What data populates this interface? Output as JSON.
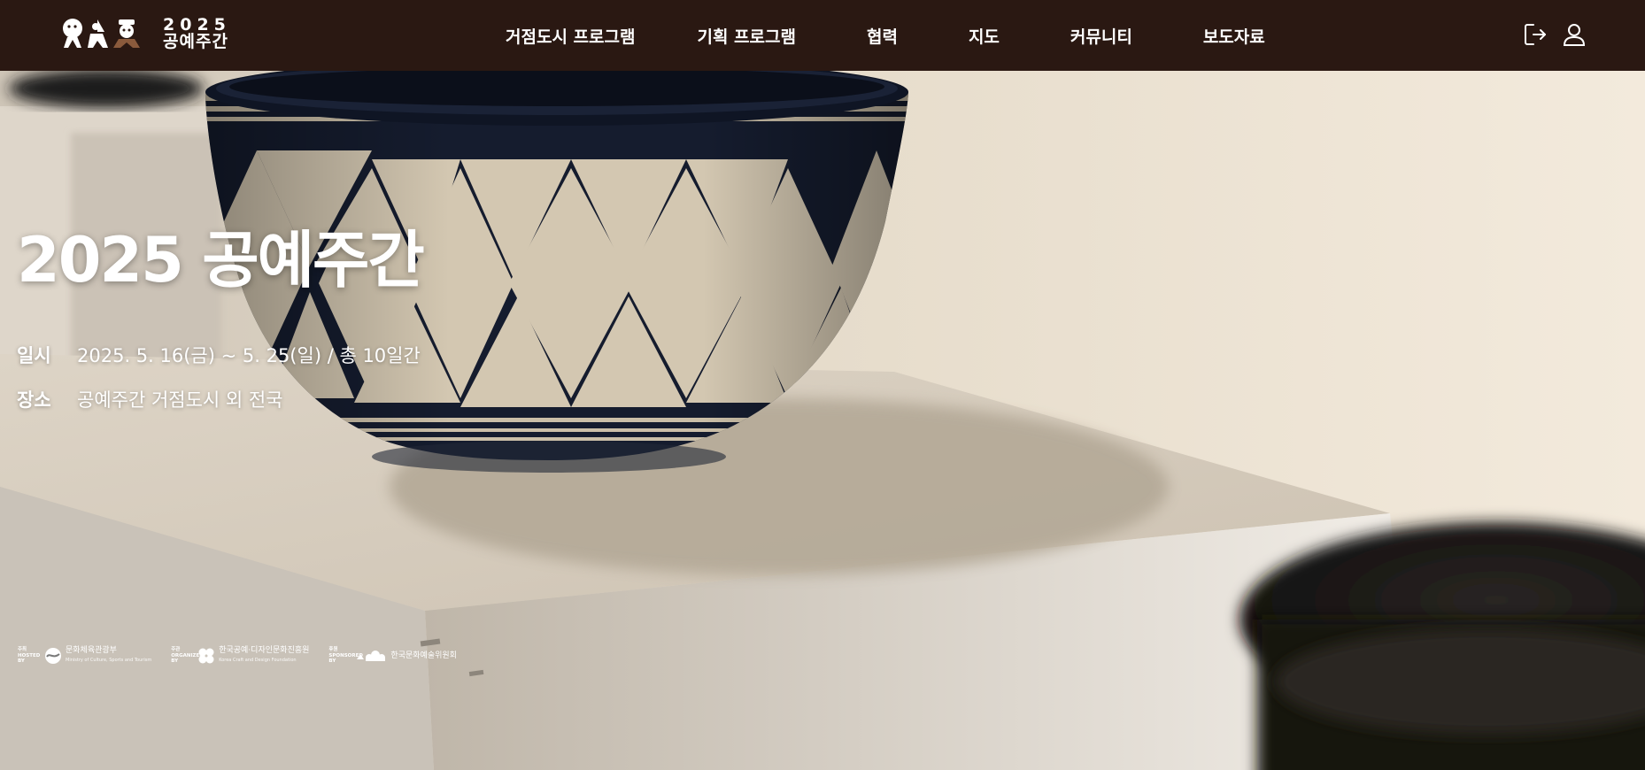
{
  "header": {
    "logo": {
      "year": "2025",
      "name": "공예주간"
    },
    "nav": [
      {
        "label": "거점도시 프로그램"
      },
      {
        "label": "기획 프로그램"
      },
      {
        "label": "협력"
      },
      {
        "label": "지도"
      },
      {
        "label": "커뮤니티"
      },
      {
        "label": "보도자료"
      }
    ],
    "icons": {
      "logout": "logout-icon",
      "user": "user-icon"
    }
  },
  "hero": {
    "title": "2025 공예주간",
    "date": {
      "label": "일시",
      "value": "2025. 5. 16(금) ~ 5. 25(일) / 총 10일간"
    },
    "place": {
      "label": "장소",
      "value": "공예주간 거점도시 외 전국"
    }
  },
  "sponsors": [
    {
      "role": "주최\nHOSTED\nBY",
      "name": "문화체육관광부",
      "sub": "Ministry of Culture, Sports and Tourism"
    },
    {
      "role": "주관\nORGANIZED\nBY",
      "name": "한국공예·디자인문화진흥원",
      "sub": "Korea Craft and Design Foundation"
    },
    {
      "role": "후원\nSPONSORED\nBY",
      "name": "한국문화예술위원회",
      "sub": ""
    }
  ],
  "colors": {
    "header_bg": "#2a1812",
    "text": "#ffffff",
    "bowl_navy": "#141b2c",
    "bowl_clay": "#d2c6b0"
  }
}
